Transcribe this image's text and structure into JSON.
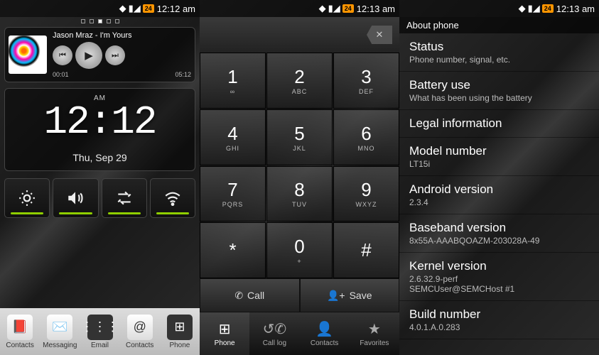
{
  "status": {
    "time1": "12:12 am",
    "time2": "12:13 am",
    "time3": "12:13 am",
    "badge": "24"
  },
  "home": {
    "music": {
      "title": "Jason Mraz - I'm Yours",
      "elapsed": "00:01",
      "total": "05:12"
    },
    "clock": {
      "ampm": "AM",
      "time": "12:12",
      "date": "Thu, Sep 29"
    },
    "toggles": [
      "brightness",
      "sound",
      "sync",
      "wifi"
    ],
    "dock": [
      {
        "label": "Contacts"
      },
      {
        "label": "Messaging"
      },
      {
        "label": "Email"
      },
      {
        "label": "Contacts"
      },
      {
        "label": "Phone"
      }
    ]
  },
  "dialer": {
    "keys": [
      {
        "digit": "1",
        "letters": "∞"
      },
      {
        "digit": "2",
        "letters": "ABC"
      },
      {
        "digit": "3",
        "letters": "DEF"
      },
      {
        "digit": "4",
        "letters": "GHI"
      },
      {
        "digit": "5",
        "letters": "JKL"
      },
      {
        "digit": "6",
        "letters": "MNO"
      },
      {
        "digit": "7",
        "letters": "PQRS"
      },
      {
        "digit": "8",
        "letters": "TUV"
      },
      {
        "digit": "9",
        "letters": "WXYZ"
      },
      {
        "digit": "*",
        "letters": ""
      },
      {
        "digit": "0",
        "letters": "+"
      },
      {
        "digit": "#",
        "letters": ""
      }
    ],
    "call": "Call",
    "save": "Save",
    "tabs": [
      {
        "label": "Phone"
      },
      {
        "label": "Call log"
      },
      {
        "label": "Contacts"
      },
      {
        "label": "Favorites"
      }
    ]
  },
  "about": {
    "header": "About phone",
    "items": [
      {
        "title": "Status",
        "sub": "Phone number, signal, etc."
      },
      {
        "title": "Battery use",
        "sub": "What has been using the battery"
      },
      {
        "title": "Legal information",
        "sub": ""
      },
      {
        "title": "Model number",
        "sub": "LT15i"
      },
      {
        "title": "Android version",
        "sub": "2.3.4"
      },
      {
        "title": "Baseband version",
        "sub": "8x55A-AAABQOAZM-203028A-49"
      },
      {
        "title": "Kernel version",
        "sub": "2.6.32.9-perf\nSEMCUser@SEMCHost #1"
      },
      {
        "title": "Build number",
        "sub": "4.0.1.A.0.283"
      }
    ]
  }
}
